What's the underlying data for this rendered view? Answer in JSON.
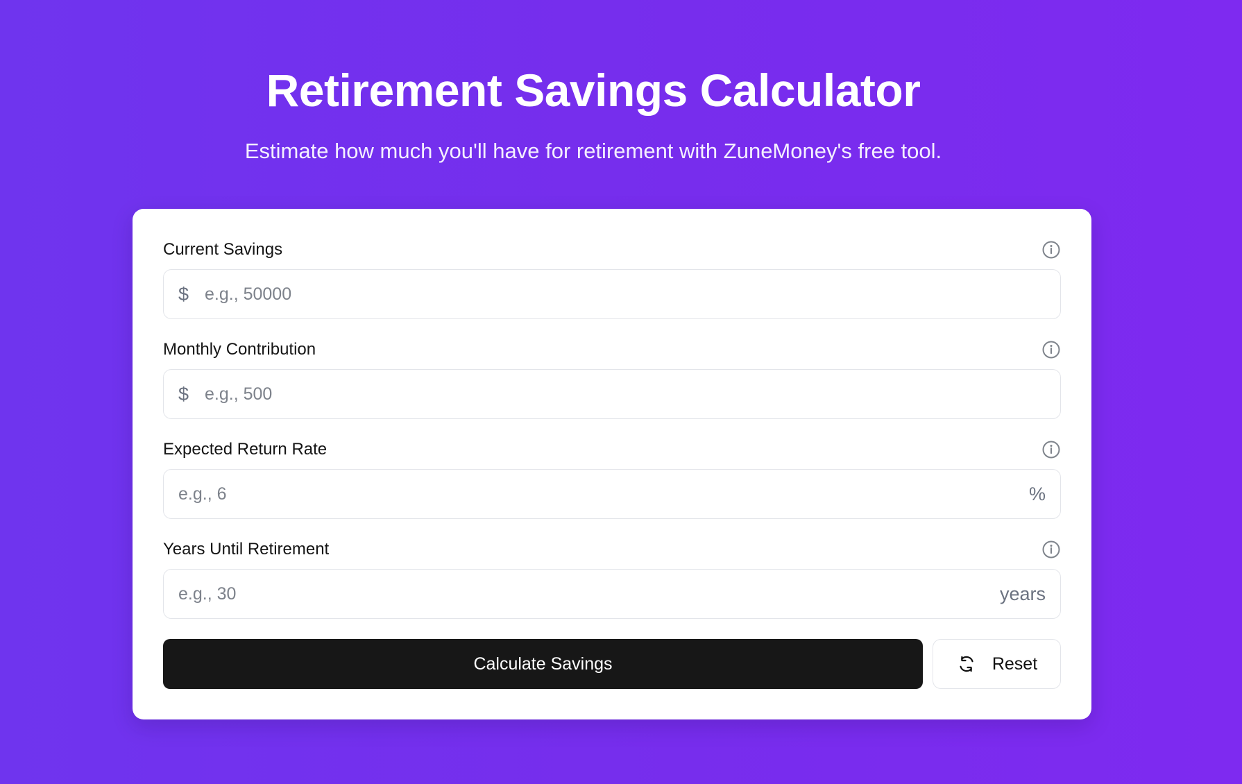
{
  "header": {
    "title": "Retirement Savings Calculator",
    "subtitle": "Estimate how much you'll have for retirement with ZuneMoney's free tool."
  },
  "form": {
    "fields": [
      {
        "label": "Current Savings",
        "prefix": "$",
        "placeholder": "e.g., 50000",
        "value": "",
        "suffix": "",
        "icon": "info-icon"
      },
      {
        "label": "Monthly Contribution",
        "prefix": "$",
        "placeholder": "e.g., 500",
        "value": "",
        "suffix": "",
        "icon": "info-icon"
      },
      {
        "label": "Expected Return Rate",
        "prefix": "",
        "placeholder": "e.g., 6",
        "value": "",
        "suffix": "%",
        "icon": "info-icon"
      },
      {
        "label": "Years Until Retirement",
        "prefix": "",
        "placeholder": "e.g., 30",
        "value": "",
        "suffix": "years",
        "icon": "info-icon"
      }
    ],
    "buttons": {
      "calculate": "Calculate Savings",
      "reset": "Reset",
      "reset_icon": "refresh-icon"
    }
  },
  "colors": {
    "background_start": "#6f34ee",
    "background_end": "#7e2af0",
    "card": "#ffffff",
    "primary_button": "#171717",
    "border": "#e3e5ea",
    "muted_text": "#7d828b"
  }
}
